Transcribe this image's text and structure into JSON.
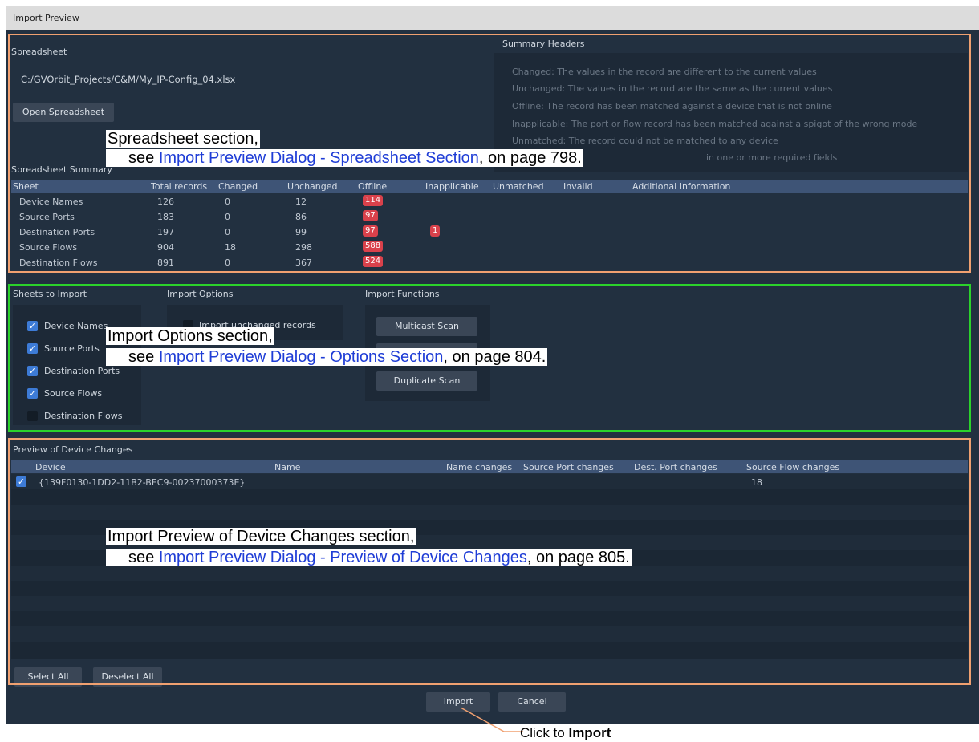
{
  "window": {
    "title": "Import Preview"
  },
  "spreadsheet": {
    "heading": "Spreadsheet",
    "path": "C:/GVOrbit_Projects/C&M/My_IP-Config_04.xlsx",
    "open_button": "Open Spreadsheet"
  },
  "summary_headers": {
    "heading": "Summary Headers",
    "lines": [
      "Changed: The values in the record are different to the current values",
      "Unchanged: The values in the record are the same as the current values",
      "Offline: The record has been matched against a device that is not online",
      "Inapplicable: The port or flow record has been matched against a spigot of the wrong mode",
      "Unmatched: The record could not be matched to any device",
      "in one or more required fields"
    ]
  },
  "spreadsheet_summary": {
    "heading": "Spreadsheet Summary",
    "columns": [
      "Sheet",
      "Total records",
      "Changed",
      "Unchanged",
      "Offline",
      "Inapplicable",
      "Unmatched",
      "Invalid",
      "Additional Information"
    ],
    "rows": [
      {
        "sheet": "Device Names",
        "total": "126",
        "changed": "0",
        "unchanged": "12",
        "offline": "114",
        "inapplicable": ""
      },
      {
        "sheet": "Source Ports",
        "total": "183",
        "changed": "0",
        "unchanged": "86",
        "offline": "97",
        "inapplicable": ""
      },
      {
        "sheet": "Destination Ports",
        "total": "197",
        "changed": "0",
        "unchanged": "99",
        "offline": "97",
        "inapplicable": "1"
      },
      {
        "sheet": "Source Flows",
        "total": "904",
        "changed": "18",
        "unchanged": "298",
        "offline": "588",
        "inapplicable": ""
      },
      {
        "sheet": "Destination Flows",
        "total": "891",
        "changed": "0",
        "unchanged": "367",
        "offline": "524",
        "inapplicable": ""
      }
    ]
  },
  "sheets_to_import": {
    "heading": "Sheets to Import",
    "items": [
      {
        "label": "Device Names",
        "checked": true
      },
      {
        "label": "Source Ports",
        "checked": true
      },
      {
        "label": "Destination Ports",
        "checked": true
      },
      {
        "label": "Source Flows",
        "checked": true
      },
      {
        "label": "Destination Flows",
        "checked": false
      }
    ]
  },
  "import_options": {
    "heading": "Import Options",
    "option_partial": "Import unchanged records"
  },
  "import_functions": {
    "heading": "Import Functions",
    "multicast": "Multicast Scan",
    "duplicate": "Duplicate Scan"
  },
  "device_changes": {
    "heading": "Preview of Device Changes",
    "columns": [
      "Device",
      "Name",
      "Name changes",
      "Source Port changes",
      "Dest. Port changes",
      "Source Flow changes"
    ],
    "rows": [
      {
        "checked": true,
        "device": "{139F0130-1DD2-11B2-BEC9-00237000373E}",
        "source_flow_changes": "18"
      }
    ],
    "select_all": "Select All",
    "deselect_all": "Deselect All"
  },
  "footer": {
    "import": "Import",
    "cancel": "Cancel"
  },
  "annotations": {
    "spreadsheet": {
      "title": "Spreadsheet section,",
      "see": "see ",
      "link": "Import Preview Dialog - Spreadsheet Section",
      "page": ", on page 798."
    },
    "options": {
      "title": "Import Options section,",
      "see": "see ",
      "link": "Import Preview Dialog - Options Section",
      "page": ", on page 804."
    },
    "preview": {
      "title": "Import Preview of Device Changes section,",
      "see": "see ",
      "link": "Import Preview Dialog - Preview of Device Changes",
      "page": ", on page 805."
    },
    "click_prefix": "Click to ",
    "click_bold": "Import"
  },
  "colors": {
    "dialog_bg": "#223040",
    "header_blue": "#3e5476",
    "badge_red": "#d9414b",
    "frame_orange": "#f0a070",
    "frame_green": "#2bd22b",
    "link_blue": "#1f3dd6"
  }
}
